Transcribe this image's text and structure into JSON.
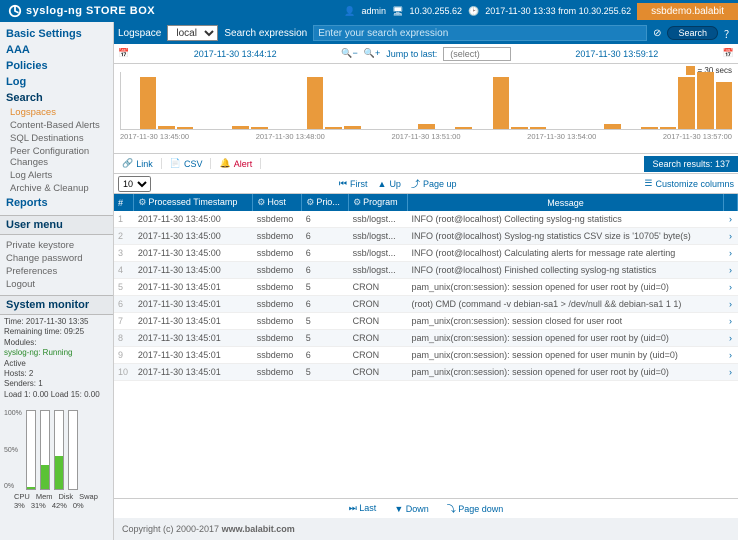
{
  "header": {
    "brand_main": "syslog-ng",
    "brand_sub": "STORE BOX",
    "user": "admin",
    "host": "10.30.255.62",
    "clock": "2017-11-30 13:33 from 10.30.255.62",
    "demo": "ssbdemo.balabit"
  },
  "nav": {
    "basic": "Basic Settings",
    "aaa": "AAA",
    "policies": "Policies",
    "log": "Log",
    "search": "Search",
    "search_sub": [
      "Logspaces",
      "Content-Based Alerts",
      "SQL Destinations",
      "Peer Configuration Changes",
      "Log Alerts",
      "Archive & Cleanup"
    ],
    "reports": "Reports"
  },
  "usermenu": {
    "title": "User menu",
    "items": [
      "Private keystore",
      "Change password",
      "Preferences",
      "Logout"
    ]
  },
  "sysmon": {
    "title": "System monitor",
    "time": "Time: 2017-11-30 13:35",
    "remain": "Remaining time: 09:25",
    "modules": "Modules:",
    "mod1": "syslog-ng: Running",
    "active": "Active",
    "hosts": "Hosts: 2",
    "senders": "Senders: 1",
    "load": "Load 1: 0.00  Load 15: 0.00",
    "labels": [
      "CPU",
      "Mem",
      "Disk",
      "Swap"
    ],
    "values": [
      "3%",
      "31%",
      "42%",
      "0%"
    ],
    "scale": [
      "100%",
      "50%",
      "0%"
    ]
  },
  "searchbar": {
    "logspace_label": "Logspace",
    "logspace_value": "local",
    "expr_label": "Search expression",
    "expr_placeholder": "Enter your search expression",
    "search_btn": "Search"
  },
  "datebar": {
    "start": "2017-11-30 13:44:12",
    "jump": "Jump to last:",
    "jump_value": "(select)",
    "end": "2017-11-30 13:59:12"
  },
  "chart_data": {
    "type": "bar",
    "legend": "= 30 secs",
    "ytick": "30",
    "x": [
      "2017-11-30 13:45:00",
      "2017-11-30 13:48:00",
      "2017-11-30 13:51:00",
      "2017-11-30 13:54:00",
      "2017-11-30 13:57:00"
    ],
    "values": [
      0,
      33,
      2,
      1,
      0,
      0,
      2,
      1,
      0,
      0,
      33,
      1,
      2,
      0,
      0,
      0,
      3,
      0,
      1,
      0,
      33,
      1,
      1,
      0,
      0,
      0,
      3,
      0,
      1,
      1,
      33,
      36,
      30
    ]
  },
  "links": {
    "link": "Link",
    "csv": "CSV",
    "alert": "Alert",
    "results": "Search results: 137"
  },
  "pager": {
    "size": "10",
    "first": "First",
    "up": "Up",
    "pageup": "Page up",
    "custom": "Customize columns",
    "last": "Last",
    "down": "Down",
    "pagedown": "Page down"
  },
  "columns": {
    "num": "#",
    "ts": "Processed Timestamp",
    "host": "Host",
    "prio": "Prio...",
    "prog": "Program",
    "msg": "Message"
  },
  "rows": [
    {
      "n": "1",
      "ts": "2017-11-30 13:45:00",
      "host": "ssbdemo",
      "prio": "6",
      "prog": "ssb/logst...",
      "msg": "INFO (root@localhost) Collecting syslog-ng statistics"
    },
    {
      "n": "2",
      "ts": "2017-11-30 13:45:00",
      "host": "ssbdemo",
      "prio": "6",
      "prog": "ssb/logst...",
      "msg": "INFO (root@localhost) Syslog-ng statistics CSV size is '10705' byte(s)"
    },
    {
      "n": "3",
      "ts": "2017-11-30 13:45:00",
      "host": "ssbdemo",
      "prio": "6",
      "prog": "ssb/logst...",
      "msg": "INFO (root@localhost) Calculating alerts for message rate alerting"
    },
    {
      "n": "4",
      "ts": "2017-11-30 13:45:00",
      "host": "ssbdemo",
      "prio": "6",
      "prog": "ssb/logst...",
      "msg": "INFO (root@localhost) Finished collecting syslog-ng statistics"
    },
    {
      "n": "5",
      "ts": "2017-11-30 13:45:01",
      "host": "ssbdemo",
      "prio": "5",
      "prog": "CRON",
      "msg": "pam_unix(cron:session): session opened for user root by (uid=0)"
    },
    {
      "n": "6",
      "ts": "2017-11-30 13:45:01",
      "host": "ssbdemo",
      "prio": "6",
      "prog": "CRON",
      "msg": "(root) CMD (command -v debian-sa1 > /dev/null && debian-sa1 1 1)"
    },
    {
      "n": "7",
      "ts": "2017-11-30 13:45:01",
      "host": "ssbdemo",
      "prio": "5",
      "prog": "CRON",
      "msg": "pam_unix(cron:session): session closed for user root"
    },
    {
      "n": "8",
      "ts": "2017-11-30 13:45:01",
      "host": "ssbdemo",
      "prio": "5",
      "prog": "CRON",
      "msg": "pam_unix(cron:session): session opened for user root by (uid=0)"
    },
    {
      "n": "9",
      "ts": "2017-11-30 13:45:01",
      "host": "ssbdemo",
      "prio": "6",
      "prog": "CRON",
      "msg": "pam_unix(cron:session): session opened for user munin by (uid=0)"
    },
    {
      "n": "10",
      "ts": "2017-11-30 13:45:01",
      "host": "ssbdemo",
      "prio": "5",
      "prog": "CRON",
      "msg": "pam_unix(cron:session): session opened for user root by (uid=0)"
    }
  ],
  "footer": {
    "copy": "Copyright (c) 2000-2017 ",
    "site": "www.balabit.com"
  }
}
